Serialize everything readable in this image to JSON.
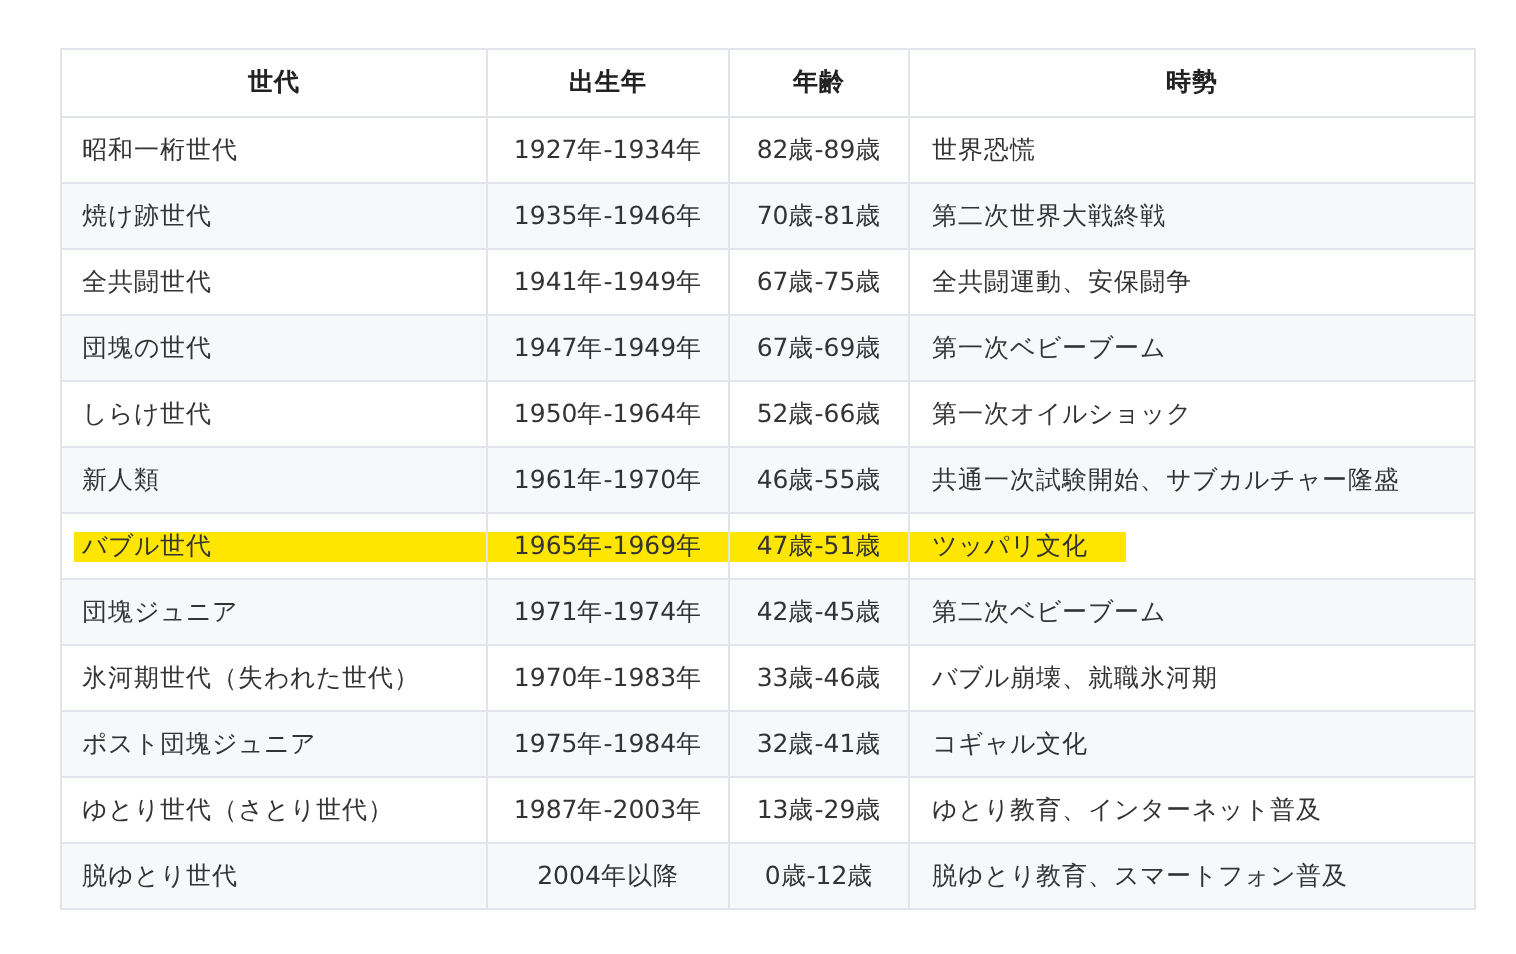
{
  "table": {
    "columns": [
      "世代",
      "出生年",
      "年齢",
      "時勢"
    ],
    "rows": [
      {
        "cells": [
          "昭和一桁世代",
          "1927年-1934年",
          "82歳-89歳",
          "世界恐慌"
        ],
        "highlighted": false
      },
      {
        "cells": [
          "焼け跡世代",
          "1935年-1946年",
          "70歳-81歳",
          "第二次世界大戦終戦"
        ],
        "highlighted": false
      },
      {
        "cells": [
          "全共闘世代",
          "1941年-1949年",
          "67歳-75歳",
          "全共闘運動、安保闘争"
        ],
        "highlighted": false
      },
      {
        "cells": [
          "団塊の世代",
          "1947年-1949年",
          "67歳-69歳",
          "第一次ベビーブーム"
        ],
        "highlighted": false
      },
      {
        "cells": [
          "しらけ世代",
          "1950年-1964年",
          "52歳-66歳",
          "第一次オイルショック"
        ],
        "highlighted": false
      },
      {
        "cells": [
          "新人類",
          "1961年-1970年",
          "46歳-55歳",
          "共通一次試験開始、サブカルチャー隆盛"
        ],
        "highlighted": false
      },
      {
        "cells": [
          "バブル世代",
          "1965年-1969年",
          "47歳-51歳",
          "ツッパリ文化"
        ],
        "highlighted": true
      },
      {
        "cells": [
          "団塊ジュニア",
          "1971年-1974年",
          "42歳-45歳",
          "第二次ベビーブーム"
        ],
        "highlighted": false
      },
      {
        "cells": [
          "氷河期世代（失われた世代）",
          "1970年-1983年",
          "33歳-46歳",
          "バブル崩壊、就職氷河期"
        ],
        "highlighted": false
      },
      {
        "cells": [
          "ポスト団塊ジュニア",
          "1975年-1984年",
          "32歳-41歳",
          "コギャル文化"
        ],
        "highlighted": false
      },
      {
        "cells": [
          "ゆとり世代（さとり世代）",
          "1987年-2003年",
          "13歳-29歳",
          "ゆとり教育、インターネット普及"
        ],
        "highlighted": false
      },
      {
        "cells": [
          "脱ゆとり世代",
          "2004年以降",
          "0歳-12歳",
          "脱ゆとり教育、スマートフォン普及"
        ],
        "highlighted": false
      }
    ]
  }
}
